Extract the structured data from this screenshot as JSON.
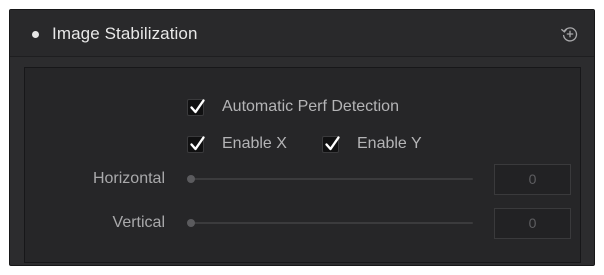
{
  "panel": {
    "title": "Image Stabilization",
    "reset_icon": "reset-rotate-plus-icon"
  },
  "options": {
    "auto_perf": {
      "label": "Automatic Perf Detection",
      "checked": true
    },
    "enable_x": {
      "label": "Enable X",
      "checked": true
    },
    "enable_y": {
      "label": "Enable Y",
      "checked": true
    }
  },
  "sliders": [
    {
      "label": "Horizontal",
      "value": "0"
    },
    {
      "label": "Vertical",
      "value": "0"
    }
  ],
  "colors": {
    "panel_bg": "#2c2c2e",
    "content_bg": "#262628",
    "text": "#b4b4b6",
    "title_text": "#e8e8e8"
  }
}
